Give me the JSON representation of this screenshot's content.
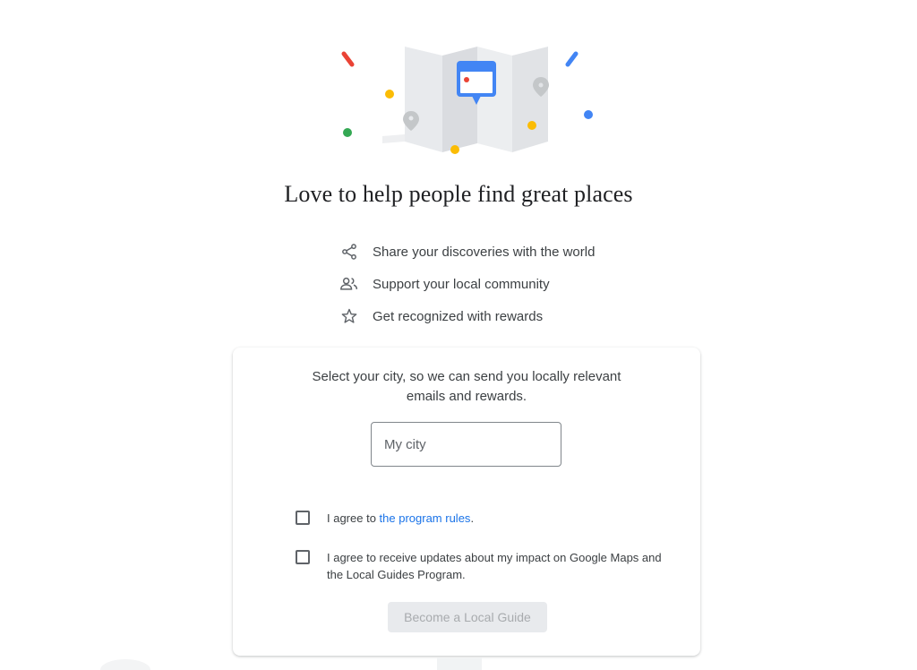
{
  "headline": "Love to help people find great places",
  "benefits": [
    {
      "icon": "share-icon",
      "label": "Share your discoveries with the world"
    },
    {
      "icon": "people-icon",
      "label": "Support your local community"
    },
    {
      "icon": "star-icon",
      "label": "Get recognized with rewards"
    }
  ],
  "card": {
    "prompt": "Select your city, so we can send you locally relevant emails and rewards.",
    "city_input": {
      "placeholder": "My city",
      "value": ""
    },
    "rules_checkbox": {
      "label_prefix": "I agree to ",
      "link_text": "the program rules",
      "label_suffix": ".",
      "checked": false
    },
    "updates_checkbox": {
      "label": "I agree to receive updates about my impact on Google Maps and the Local Guides Program.",
      "checked": false
    },
    "submit_label": "Become a Local Guide",
    "submit_disabled": true
  },
  "colors": {
    "brand_blue": "#4285f4",
    "brand_red": "#ea4335",
    "brand_yellow": "#fbbc04",
    "brand_green": "#34a853",
    "link_blue": "#1a73e8",
    "text": "#3c4043"
  }
}
